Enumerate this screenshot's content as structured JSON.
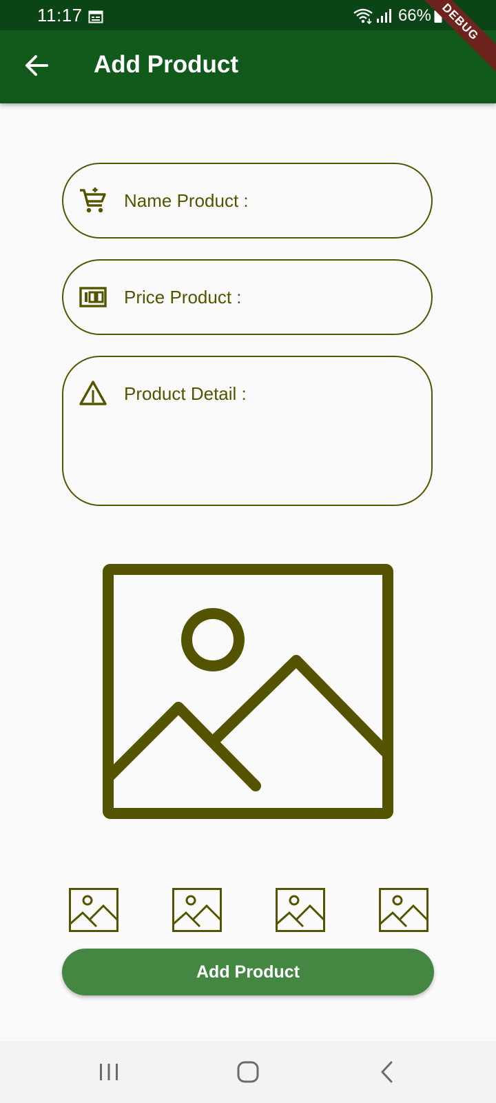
{
  "status_bar": {
    "time": "11:17",
    "battery": "66%",
    "icons": [
      "calendar-icon",
      "wifi-icon",
      "signal-icon",
      "battery-icon"
    ]
  },
  "app_bar": {
    "title": "Add Product",
    "back_icon": "arrow-back-icon"
  },
  "debug_banner": "DEBUG",
  "form": {
    "name_label": "Name Product :",
    "name_icon": "cart-icon",
    "price_label": "Price Product :",
    "price_icon": "money-icon",
    "detail_label": "Product Detail :",
    "detail_icon": "warning-icon"
  },
  "images": {
    "main_icon": "image-placeholder-icon",
    "thumbnail_count": 4
  },
  "submit_button": "Add Product",
  "nav_bar": {
    "icons": [
      "recent-apps-icon",
      "home-icon",
      "back-icon"
    ]
  },
  "colors": {
    "status_bar": "#0b4515",
    "app_bar": "#125a1b",
    "accent_olive": "#545400",
    "button": "#438743",
    "background": "#fafafa",
    "debug": "#6f231e"
  }
}
